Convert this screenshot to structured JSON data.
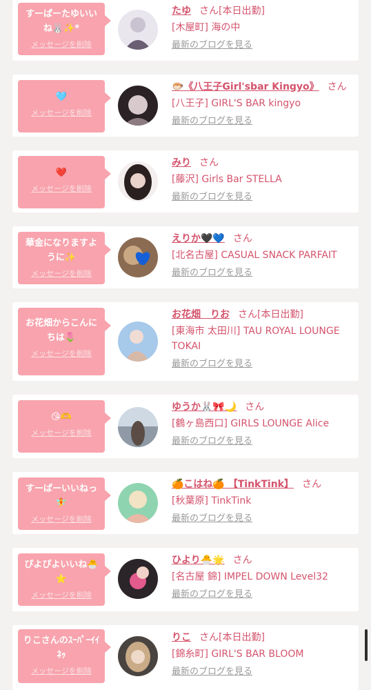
{
  "delete_label": "メッセージを削除",
  "blog_label": "最新のブログを見る",
  "san": "さん",
  "colors": {
    "bubble": "#f8a3ad",
    "accent": "#d4536c",
    "background": "#f4f1f1"
  },
  "cards": [
    {
      "message": "すーぱーたゆいいね🐰✨*",
      "name": "たゆ",
      "badge": "[本日出勤]",
      "detail": "[木屋町] 海の中",
      "avatar_colors": [
        "#e9e6ee",
        "#c9c2d0",
        "#6a5e73"
      ]
    },
    {
      "message": "🩵",
      "name": "🐡《八王子Girl'sbar Kingyo》",
      "badge": "",
      "detail": "[八王子] GIRL'S BAR kingyo",
      "avatar_colors": [
        "#2a2224",
        "#d8c9cc",
        "#8c7b80"
      ]
    },
    {
      "message": "❤️",
      "name": "みり",
      "badge": "",
      "detail": "[藤沢] Girls Bar STELLA",
      "avatar_colors": [
        "#f4eeee",
        "#2a2020",
        "#e8d2ca"
      ]
    },
    {
      "message": "華金になりますように✨",
      "name": "えりか🖤💙",
      "badge": "",
      "detail": "[北名古屋] CASUAL SNACK PARFAIT",
      "avatar_colors": [
        "#8b6b52",
        "#c9a883",
        "#1560d8"
      ]
    },
    {
      "message": "お花畑からこんにちは🌷",
      "name": "お花畑　りお",
      "badge": "[本日出勤]",
      "detail": "[東海市 太田川] TAU ROYAL LOUNGE TOKAI",
      "avatar_colors": [
        "#a7c9ea",
        "#f1dcd4",
        "#d7b9a8"
      ]
    },
    {
      "message": "😘🫶",
      "name": "ゆうか🐰🎀🌙",
      "badge": "",
      "detail": "[鶴ヶ島西口] GIRLS LOUNGE Alice",
      "avatar_colors": [
        "#cfd9e3",
        "#8f9aa6",
        "#5b4d45"
      ]
    },
    {
      "message": "すーぱーいいねっ🧚",
      "name": "🍊こはね🍊 【TinkTink】",
      "badge": "",
      "detail": "[秋葉原] TinkTink",
      "avatar_colors": [
        "#8fd4b0",
        "#f1e3c4",
        "#e9b8a6"
      ]
    },
    {
      "message": "ぴよぴよいいね🐣⭐",
      "name": "ひより🐣🌟",
      "badge": "",
      "detail": "[名古屋 錦] IMPEL DOWN Level32",
      "avatar_colors": [
        "#2b2428",
        "#e35a8d",
        "#f2d1c8"
      ]
    },
    {
      "message": "りこさんのｽｰﾊﾟｰｲｲﾈｯ",
      "name": "りこ",
      "badge": "[本日出勤]",
      "detail": "[錦糸町] GIRL'S BAR BLOOM",
      "avatar_colors": [
        "#4a4440",
        "#c9ab88",
        "#efd9c9"
      ]
    }
  ]
}
